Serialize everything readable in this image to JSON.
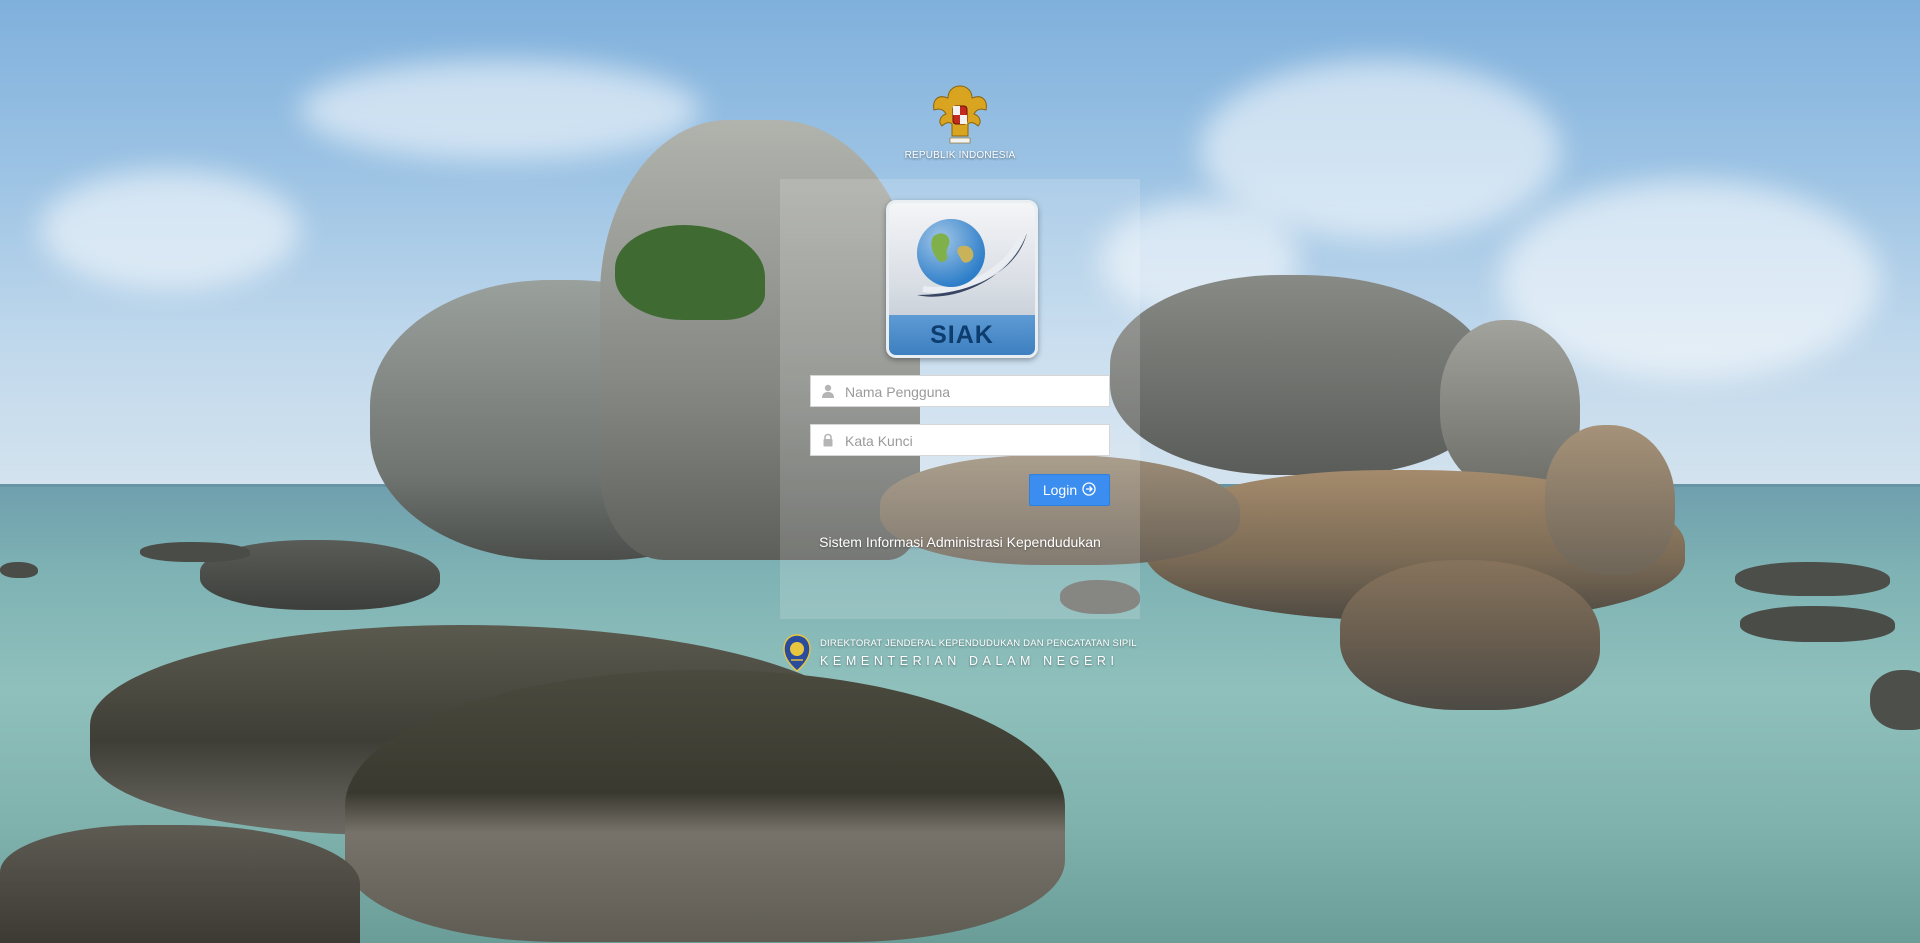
{
  "header": {
    "emblem_icon": "garuda-emblem-icon",
    "emblem_text": "REPUBLIK INDONESIA"
  },
  "logo": {
    "icon": "globe-icon",
    "text": "SIAK"
  },
  "form": {
    "username": {
      "placeholder": "Nama Pengguna",
      "value": "",
      "icon": "user-icon"
    },
    "password": {
      "placeholder": "Kata Kunci",
      "value": "",
      "icon": "lock-icon"
    },
    "login_label": "Login",
    "login_icon": "arrow-right-circle-icon"
  },
  "tagline": "Sistem Informasi Administrasi Kependudukan",
  "footer": {
    "logo_icon": "dukcapil-logo-icon",
    "line1": "DIREKTORAT JENDERAL KEPENDUDUKAN DAN PENCATATAN SIPIL",
    "line2": "KEMENTERIAN DALAM NEGERI"
  },
  "colors": {
    "primary_button": "#3b8ef0",
    "logo_band": "#3d7fc0"
  }
}
